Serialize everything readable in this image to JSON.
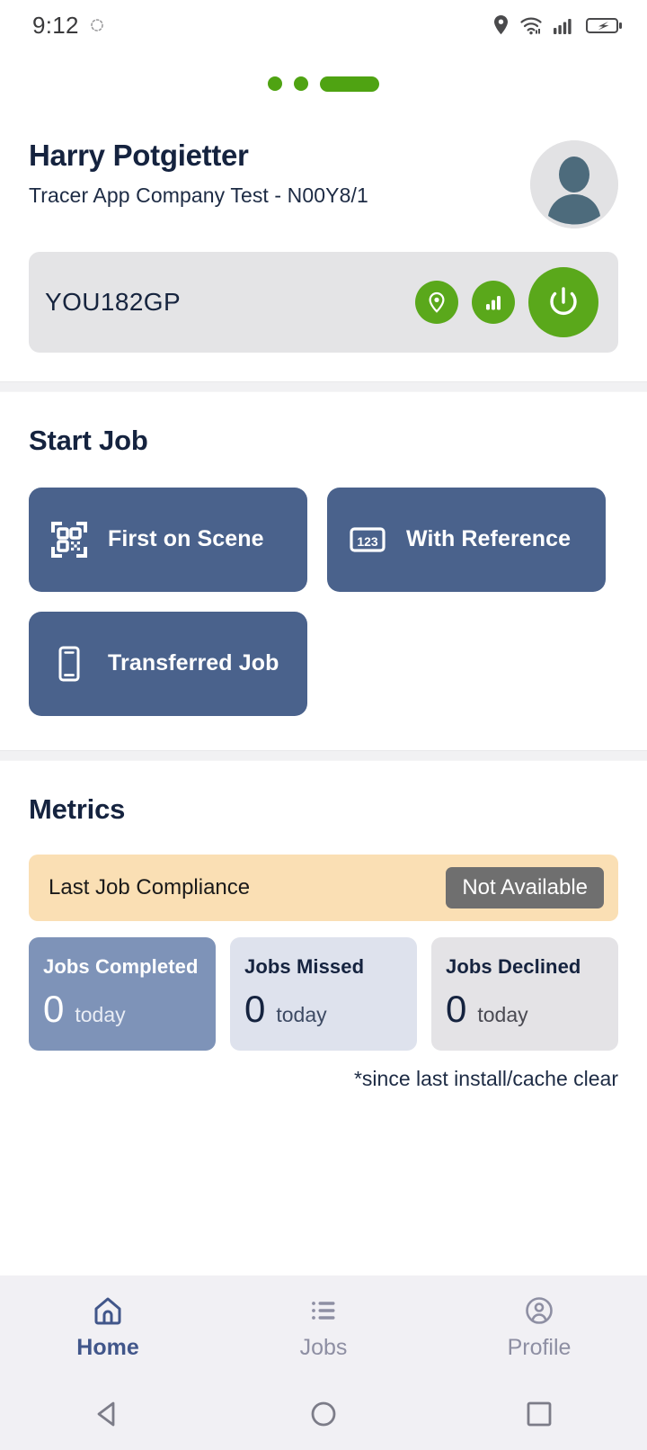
{
  "status_bar": {
    "time": "9:12",
    "icons": [
      "sun-loading-icon",
      "location-icon",
      "wifi-icon",
      "cellular-signal-icon",
      "battery-charging-icon"
    ]
  },
  "pager": {
    "dots": 3,
    "active_index": 2,
    "color": "#4fa312"
  },
  "header": {
    "user_name": "Harry Potgietter",
    "company_line": "Tracer App Company Test - N00Y8/1",
    "avatar_alt": "user-avatar-placeholder",
    "vehicle": {
      "plate": "YOU182GP",
      "actions": [
        {
          "name": "location-icon",
          "label": "Location"
        },
        {
          "name": "signal-bars-icon",
          "label": "Signal"
        },
        {
          "name": "power-icon",
          "label": "Power"
        }
      ],
      "accent": "#5aa81b",
      "background": "#e4e4e6"
    }
  },
  "start_job": {
    "title": "Start Job",
    "buttons": [
      {
        "label": "First on Scene",
        "icon": "qr-scan-icon"
      },
      {
        "label": "With Reference",
        "icon": "reference-number-icon"
      },
      {
        "label": "Transferred Job",
        "icon": "mobile-phone-icon"
      }
    ],
    "button_color": "#4a628c"
  },
  "metrics": {
    "title": "Metrics",
    "compliance": {
      "label": "Last Job Compliance",
      "status": "Not Available",
      "banner_color": "#fadfb4",
      "badge_color": "#6f6f6f"
    },
    "cards": [
      {
        "title": "Jobs Completed",
        "value": "0",
        "unit": "today"
      },
      {
        "title": "Jobs Missed",
        "value": "0",
        "unit": "today"
      },
      {
        "title": "Jobs Declined",
        "value": "0",
        "unit": "today"
      }
    ],
    "footnote": "*since last install/cache clear"
  },
  "bottom_nav": {
    "items": [
      {
        "label": "Home",
        "icon": "home-icon",
        "active": true
      },
      {
        "label": "Jobs",
        "icon": "list-icon",
        "active": false
      },
      {
        "label": "Profile",
        "icon": "profile-circle-icon",
        "active": false
      }
    ],
    "active_color": "#41568a",
    "inactive_color": "#8e8fa3"
  },
  "system_nav": {
    "buttons": [
      "back-triangle-icon",
      "home-circle-icon",
      "recents-square-icon"
    ]
  }
}
